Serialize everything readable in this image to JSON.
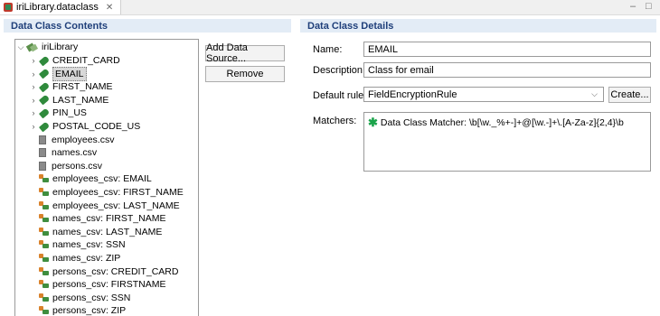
{
  "tab": {
    "title": "iriLibrary.dataclass",
    "close": "✕"
  },
  "window": {
    "minimize": "–",
    "maximize": "□"
  },
  "left_panel": {
    "title": "Data Class Contents"
  },
  "right_panel": {
    "title": "Data Class Details"
  },
  "tree": {
    "root": "iriLibrary",
    "items": [
      {
        "label": "CREDIT_CARD",
        "icon": "tag-icon",
        "expandable": true
      },
      {
        "label": "EMAIL",
        "icon": "tag-icon",
        "expandable": true,
        "selected": true
      },
      {
        "label": "FIRST_NAME",
        "icon": "tag-icon",
        "expandable": true
      },
      {
        "label": "LAST_NAME",
        "icon": "tag-icon",
        "expandable": true
      },
      {
        "label": "PIN_US",
        "icon": "tag-icon",
        "expandable": true
      },
      {
        "label": "POSTAL_CODE_US",
        "icon": "tag-icon",
        "expandable": true
      },
      {
        "label": "employees.csv",
        "icon": "csv-file-icon"
      },
      {
        "label": "names.csv",
        "icon": "csv-file-icon"
      },
      {
        "label": "persons.csv",
        "icon": "csv-file-icon"
      },
      {
        "label": "employees_csv: EMAIL",
        "icon": "field-key-icon"
      },
      {
        "label": "employees_csv: FIRST_NAME",
        "icon": "field-key-icon"
      },
      {
        "label": "employees_csv: LAST_NAME",
        "icon": "field-key-icon"
      },
      {
        "label": "names_csv: FIRST_NAME",
        "icon": "field-key-icon"
      },
      {
        "label": "names_csv: LAST_NAME",
        "icon": "field-key-icon"
      },
      {
        "label": "names_csv: SSN",
        "icon": "field-key-icon"
      },
      {
        "label": "names_csv: ZIP",
        "icon": "field-key-icon"
      },
      {
        "label": "persons_csv: CREDIT_CARD",
        "icon": "field-key-icon"
      },
      {
        "label": "persons_csv: FIRSTNAME",
        "icon": "field-key-icon"
      },
      {
        "label": "persons_csv: SSN",
        "icon": "field-key-icon"
      },
      {
        "label": "persons_csv: ZIP",
        "icon": "field-key-icon"
      }
    ]
  },
  "buttons": {
    "add_data_source": "Add Data Source...",
    "remove": "Remove",
    "create": "Create..."
  },
  "details": {
    "name_label": "Name:",
    "name_value": "EMAIL",
    "description_label": "Description:",
    "description_value": "Class for email",
    "default_rule_label": "Default rule:",
    "default_rule_value": "FieldEncryptionRule",
    "matchers_label": "Matchers:",
    "matcher_entry": "Data Class Matcher: \\b[\\w._%+-]+@[\\w.-]+\\.[A-Za-z]{2,4}\\b"
  },
  "colors": {
    "header_bg": "#e3ecf6",
    "header_text": "#1f3f7a",
    "tag_green": "#2f8a3c",
    "matcher_icon": "#1aa34a"
  }
}
